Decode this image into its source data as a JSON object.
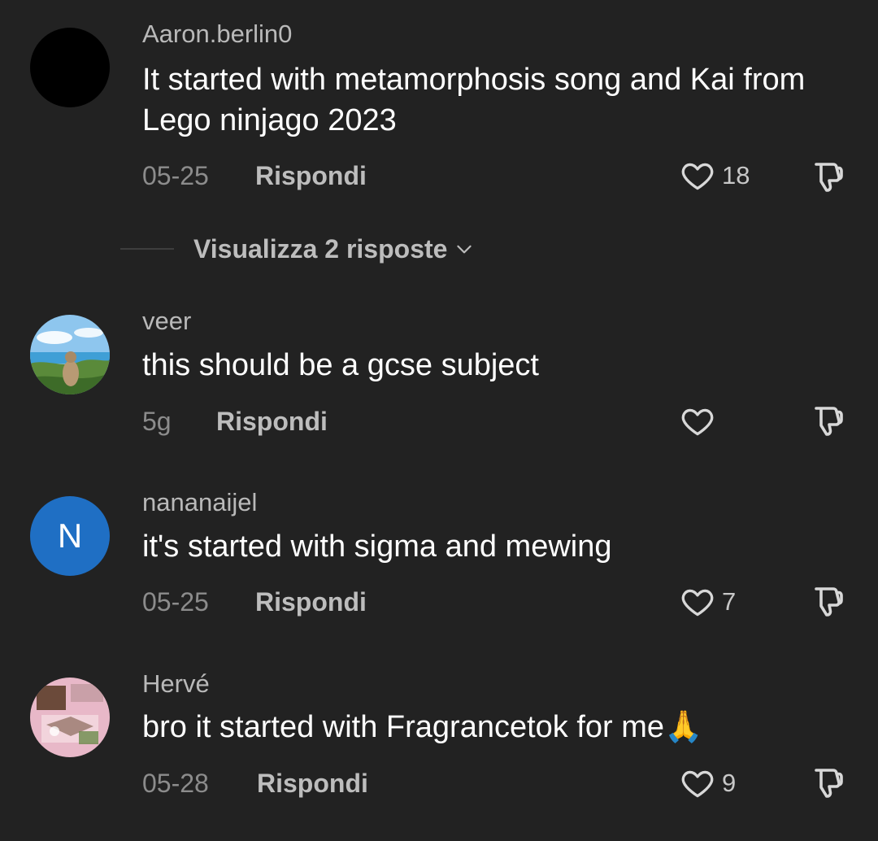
{
  "comments": [
    {
      "username": "Aaron.berlin0",
      "text": "It started with metamorphosis song and Kai from Lego ninjago 2023",
      "date": "05-25",
      "reply_label": "Rispondi",
      "like_count": "18",
      "avatar": "black-circle-avatar"
    },
    {
      "username": "veer",
      "text": "this should be a gcse subject",
      "date": "5g",
      "reply_label": "Rispondi",
      "like_count": "",
      "avatar": "photo-avatar-monkey-seaside"
    },
    {
      "username": "nananaijel",
      "text": "it's started with sigma and mewing",
      "date": "05-25",
      "reply_label": "Rispondi",
      "like_count": "7",
      "avatar": "letter-avatar",
      "avatar_letter": "N"
    },
    {
      "username": "Hervé",
      "text": "bro it started with Fragrancetok for me🙏",
      "date": "05-28",
      "reply_label": "Rispondi",
      "like_count": "9",
      "avatar": "photo-avatar-pink-collage"
    }
  ],
  "view_replies": {
    "label": "Visualizza 2 risposte"
  },
  "icons": {
    "like": "heart-outline-icon",
    "dislike": "thumbs-down-outline-icon",
    "expand": "chevron-down-icon"
  },
  "colors": {
    "background": "#222222",
    "avatar_letter_bg": "#1f6fc4"
  }
}
